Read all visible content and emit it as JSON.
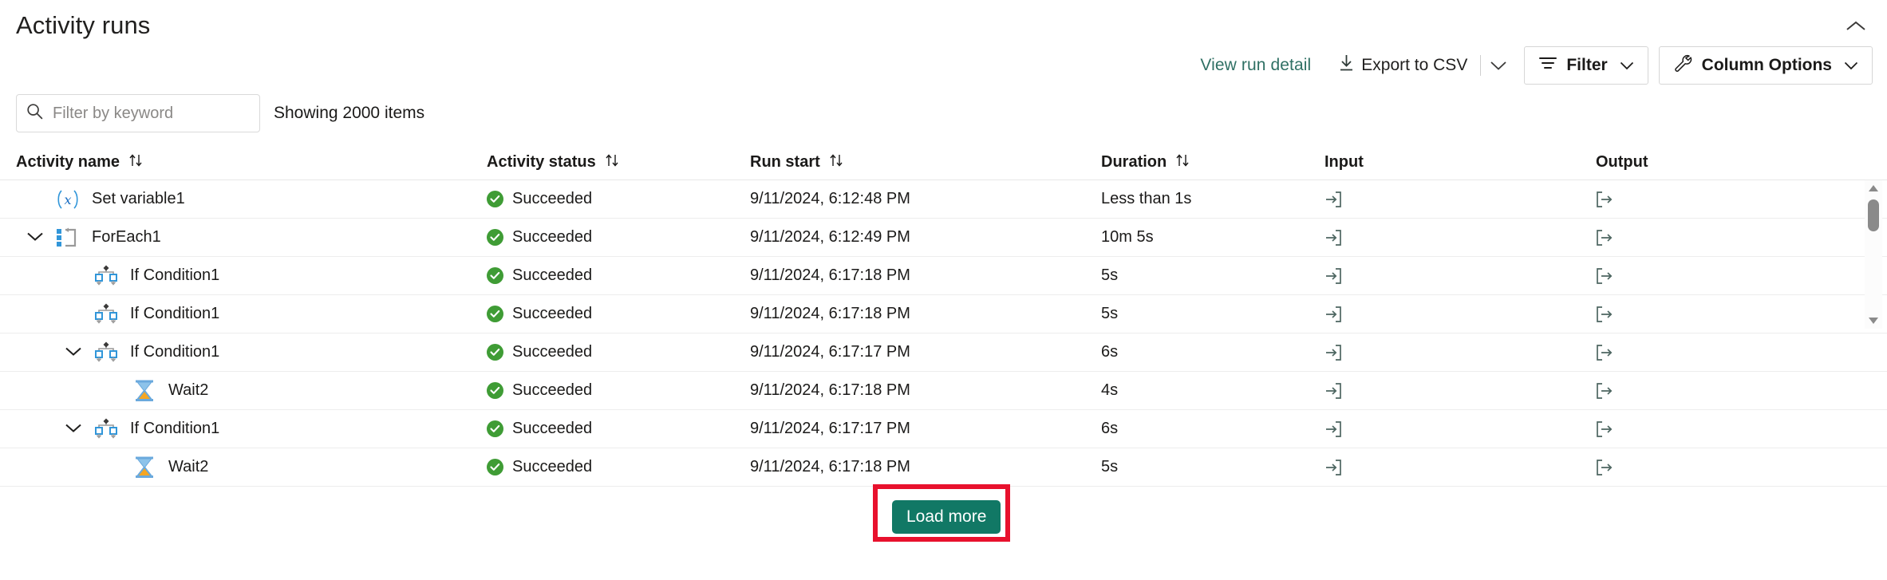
{
  "header": {
    "title": "Activity runs",
    "collapse_icon": "chevron-up-icon"
  },
  "toolbar": {
    "view_run_detail": "View run detail",
    "export_csv": "Export to CSV",
    "export_icon": "download-icon",
    "export_caret_icon": "chevron-down-icon",
    "filter": "Filter",
    "filter_icon": "filter-icon",
    "filter_caret_icon": "chevron-down-icon",
    "column_options": "Column Options",
    "column_options_icon": "wrench-icon",
    "column_options_caret_icon": "chevron-down-icon"
  },
  "search": {
    "placeholder": "Filter by keyword",
    "value": "",
    "icon": "search-icon"
  },
  "status_summary": "Showing 2000 items",
  "table": {
    "columns": [
      {
        "key": "name",
        "label": "Activity name",
        "sortable": true,
        "sort_icon": "sort-arrows-icon"
      },
      {
        "key": "status",
        "label": "Activity status",
        "sortable": true,
        "sort_icon": "sort-arrows-icon"
      },
      {
        "key": "start",
        "label": "Run start",
        "sortable": true,
        "sort_icon": "sort-arrows-icon"
      },
      {
        "key": "dur",
        "label": "Duration",
        "sortable": true,
        "sort_icon": "sort-arrows-icon"
      },
      {
        "key": "input",
        "label": "Input",
        "sortable": false,
        "sort_icon": ""
      },
      {
        "key": "output",
        "label": "Output",
        "sortable": false,
        "sort_icon": ""
      }
    ],
    "rows": [
      {
        "name": "Set variable1",
        "icon": "set-variable-icon",
        "indent": 0,
        "expandable": false,
        "expanded": false,
        "status": "Succeeded",
        "status_icon": "success-check-icon",
        "start": "9/11/2024, 6:12:48 PM",
        "duration": "Less than 1s",
        "input_icon": "input-arrow-icon",
        "output_icon": "output-arrow-icon"
      },
      {
        "name": "ForEach1",
        "icon": "foreach-loop-icon",
        "indent": 0,
        "expandable": true,
        "expanded": true,
        "status": "Succeeded",
        "status_icon": "success-check-icon",
        "start": "9/11/2024, 6:12:49 PM",
        "duration": "10m 5s",
        "input_icon": "input-arrow-icon",
        "output_icon": "output-arrow-icon"
      },
      {
        "name": "If Condition1",
        "icon": "if-condition-icon",
        "indent": 1,
        "expandable": false,
        "expanded": false,
        "status": "Succeeded",
        "status_icon": "success-check-icon",
        "start": "9/11/2024, 6:17:18 PM",
        "duration": "5s",
        "input_icon": "input-arrow-icon",
        "output_icon": "output-arrow-icon"
      },
      {
        "name": "If Condition1",
        "icon": "if-condition-icon",
        "indent": 1,
        "expandable": false,
        "expanded": false,
        "status": "Succeeded",
        "status_icon": "success-check-icon",
        "start": "9/11/2024, 6:17:18 PM",
        "duration": "5s",
        "input_icon": "input-arrow-icon",
        "output_icon": "output-arrow-icon"
      },
      {
        "name": "If Condition1",
        "icon": "if-condition-icon",
        "indent": 1,
        "expandable": true,
        "expanded": true,
        "status": "Succeeded",
        "status_icon": "success-check-icon",
        "start": "9/11/2024, 6:17:17 PM",
        "duration": "6s",
        "input_icon": "input-arrow-icon",
        "output_icon": "output-arrow-icon"
      },
      {
        "name": "Wait2",
        "icon": "wait-hourglass-icon",
        "indent": 2,
        "expandable": false,
        "expanded": false,
        "status": "Succeeded",
        "status_icon": "success-check-icon",
        "start": "9/11/2024, 6:17:18 PM",
        "duration": "4s",
        "input_icon": "input-arrow-icon",
        "output_icon": "output-arrow-icon"
      },
      {
        "name": "If Condition1",
        "icon": "if-condition-icon",
        "indent": 1,
        "expandable": true,
        "expanded": true,
        "status": "Succeeded",
        "status_icon": "success-check-icon",
        "start": "9/11/2024, 6:17:17 PM",
        "duration": "6s",
        "input_icon": "input-arrow-icon",
        "output_icon": "output-arrow-icon"
      },
      {
        "name": "Wait2",
        "icon": "wait-hourglass-icon",
        "indent": 2,
        "expandable": false,
        "expanded": false,
        "status": "Succeeded",
        "status_icon": "success-check-icon",
        "start": "9/11/2024, 6:17:18 PM",
        "duration": "5s",
        "input_icon": "input-arrow-icon",
        "output_icon": "output-arrow-icon"
      }
    ]
  },
  "scrollbar": {
    "up_icon": "scroll-up-arrow-icon",
    "down_icon": "scroll-down-arrow-icon"
  },
  "footer": {
    "load_more": "Load more"
  },
  "colors": {
    "accent_teal": "#117865",
    "link_teal": "#2f7064",
    "success_green": "#3f9c35",
    "highlight_red": "#e8112d",
    "icon_blue": "#3196d9",
    "text": "#1b1a19"
  }
}
